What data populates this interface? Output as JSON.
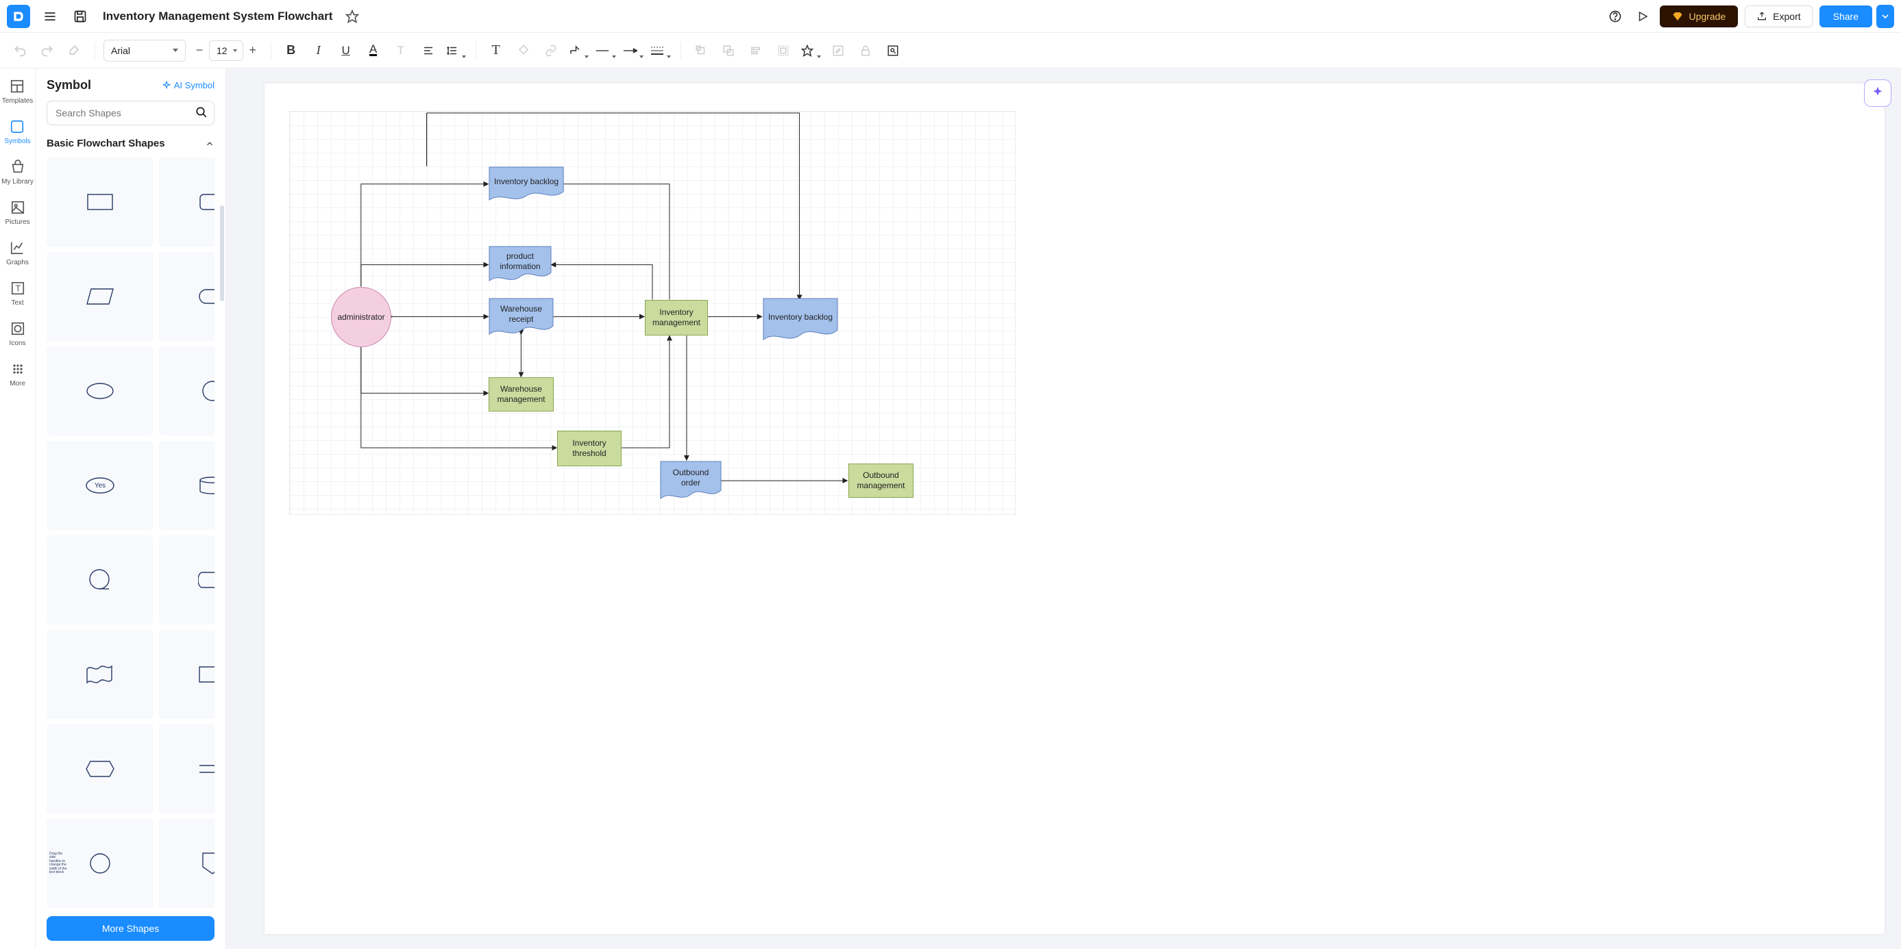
{
  "header": {
    "title": "Inventory Management System Flowchart",
    "upgrade": "Upgrade",
    "export": "Export",
    "share": "Share"
  },
  "toolbar": {
    "font": "Arial",
    "size": "12"
  },
  "rail": {
    "templates": "Templates",
    "symbols": "Symbols",
    "library": "My Library",
    "pictures": "Pictures",
    "graphs": "Graphs",
    "text": "Text",
    "icons": "Icons",
    "more": "More"
  },
  "panel": {
    "title": "Symbol",
    "ai": "AI Symbol",
    "searchPlaceholder": "Search Shapes",
    "section": "Basic Flowchart Shapes",
    "moreShapes": "More Shapes",
    "yesLabel": "Yes",
    "dragHandlesHint": "Drag the side handles to change the width of the text block"
  },
  "nodes": {
    "admin": "administrator",
    "invBacklog1": "Inventory backlog",
    "productInfo": "product information",
    "warehouseReceipt": "Warehouse receipt",
    "warehouseMgmt": "Warehouse management",
    "invMgmt": "Inventory management",
    "invThreshold": "Inventory threshold",
    "invBacklog2": "Inventory backlog",
    "outboundOrder": "Outbound order",
    "outboundMgmt": "Outbound management"
  }
}
